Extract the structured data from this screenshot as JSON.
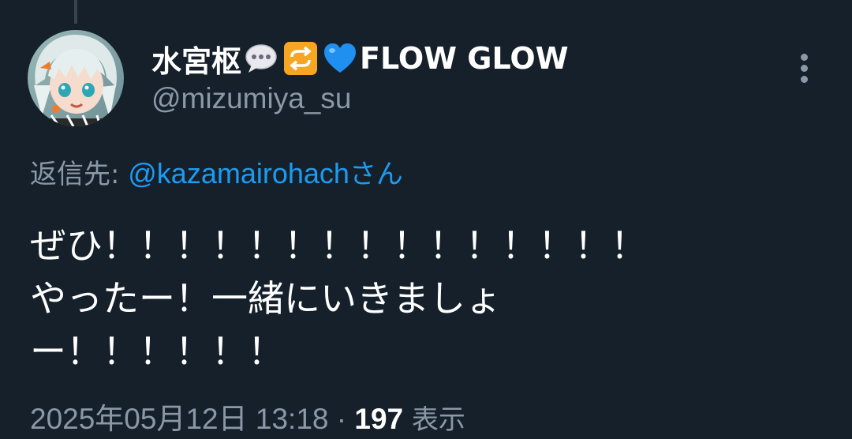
{
  "tweet": {
    "author": {
      "display_name": "水宮枢",
      "name_suffix": "FLOW GLOW",
      "name_emojis": [
        "speech-bubble-icon",
        "repeat-icon",
        "blue-heart-icon"
      ],
      "handle": "@mizumiya_su",
      "avatar_icon": "anime-avatar"
    },
    "reply": {
      "prefix": "返信先: ",
      "mention": "@kazamairohach",
      "suffix": "さん"
    },
    "text": "ぜひ！！！！！！！！！！！！！！！\nやったー！一緒にいきましょ\nー！！！！！！",
    "timestamp": "2025年05月12日 13:18",
    "separator": " · ",
    "view_count": "197",
    "view_label": " 表示"
  },
  "colors": {
    "background": "#15202b",
    "text_primary": "#ffffff",
    "text_secondary": "#8b98a5",
    "accent": "#1d9bf0"
  },
  "icons": {
    "more": "more-vertical-icon"
  }
}
